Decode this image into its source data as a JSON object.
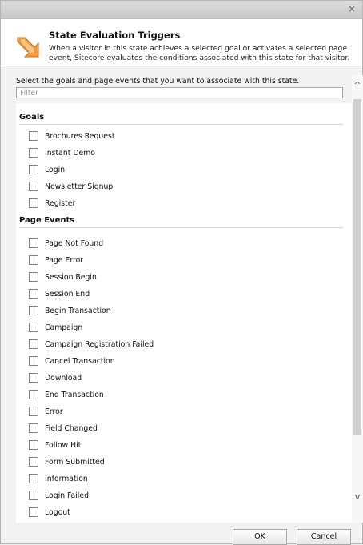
{
  "dialog": {
    "close_glyph": "×",
    "title": "State Evaluation Triggers",
    "description": "When a visitor in this state achieves a selected goal or activates a selected page event, Sitecore evaluates the conditions associated with this state for that visitor.",
    "instruction": "Select the goals and page events that you want to associate with this state.",
    "filter_placeholder": "Filter"
  },
  "goals": {
    "heading": "Goals",
    "items": [
      "Brochures Request",
      "Instant Demo",
      "Login",
      "Newsletter Signup",
      "Register"
    ]
  },
  "page_events": {
    "heading": "Page Events",
    "items": [
      "Page Not Found",
      "Page Error",
      "Session Begin",
      "Session End",
      "Begin Transaction",
      "Campaign",
      "Campaign Registration Failed",
      "Cancel Transaction",
      "Download",
      "End Transaction",
      "Error",
      "Field Changed",
      "Follow Hit",
      "Form Submitted",
      "Information",
      "Login Failed",
      "Logout"
    ]
  },
  "scrollbar": {
    "up_glyph": "^",
    "down_glyph": "v"
  },
  "buttons": {
    "ok": "OK",
    "cancel": "Cancel"
  }
}
